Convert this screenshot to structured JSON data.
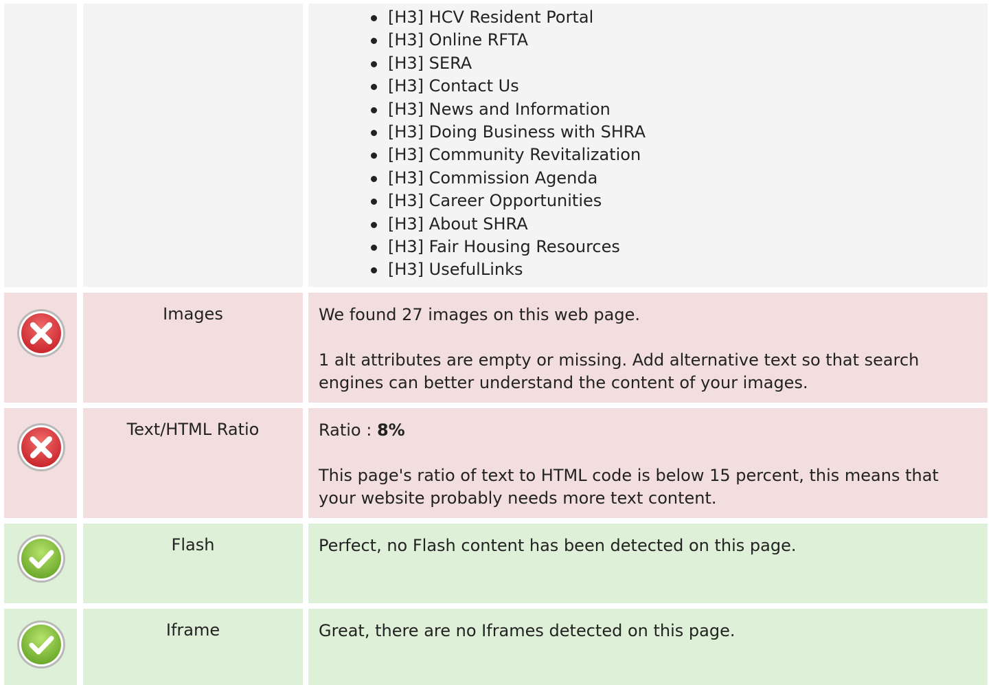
{
  "heading_list": [
    "[H3] HCV Resident Portal",
    "[H3] Online RFTA",
    "[H3] SERA",
    "[H3] Contact Us",
    "[H3] News and Information",
    "[H3] Doing Business with SHRA",
    "[H3] Community Revitalization",
    "[H3] Commission Agenda",
    "[H3] Career Opportunities",
    "[H3] About SHRA",
    "[H3] Fair Housing Resources",
    "[H3] UsefulLinks"
  ],
  "rows": [
    {
      "status": "error",
      "icon": "error-icon",
      "label": "Images",
      "text1": "We found 27 images on this web page.",
      "text2": "1 alt attributes are empty or missing. Add alternative text so that search engines can better understand the content of your images."
    },
    {
      "status": "error",
      "icon": "error-icon",
      "label": "Text/HTML Ratio",
      "ratio_prefix": "Ratio : ",
      "ratio_value": "8%",
      "text2": "This page's ratio of text to HTML code is below 15 percent, this means that your website probably needs more text content."
    },
    {
      "status": "ok",
      "icon": "check-icon",
      "label": "Flash",
      "text1": "Perfect, no Flash content has been detected on this page."
    },
    {
      "status": "ok",
      "icon": "check-icon",
      "label": "Iframe",
      "text1": "Great, there are no Iframes detected on this page."
    }
  ],
  "colors": {
    "error_bg": "#f2dede",
    "ok_bg": "#dff0d8",
    "neutral_bg": "#f4f4f4",
    "error_icon": "#d9343a",
    "ok_icon": "#8cc63f"
  }
}
